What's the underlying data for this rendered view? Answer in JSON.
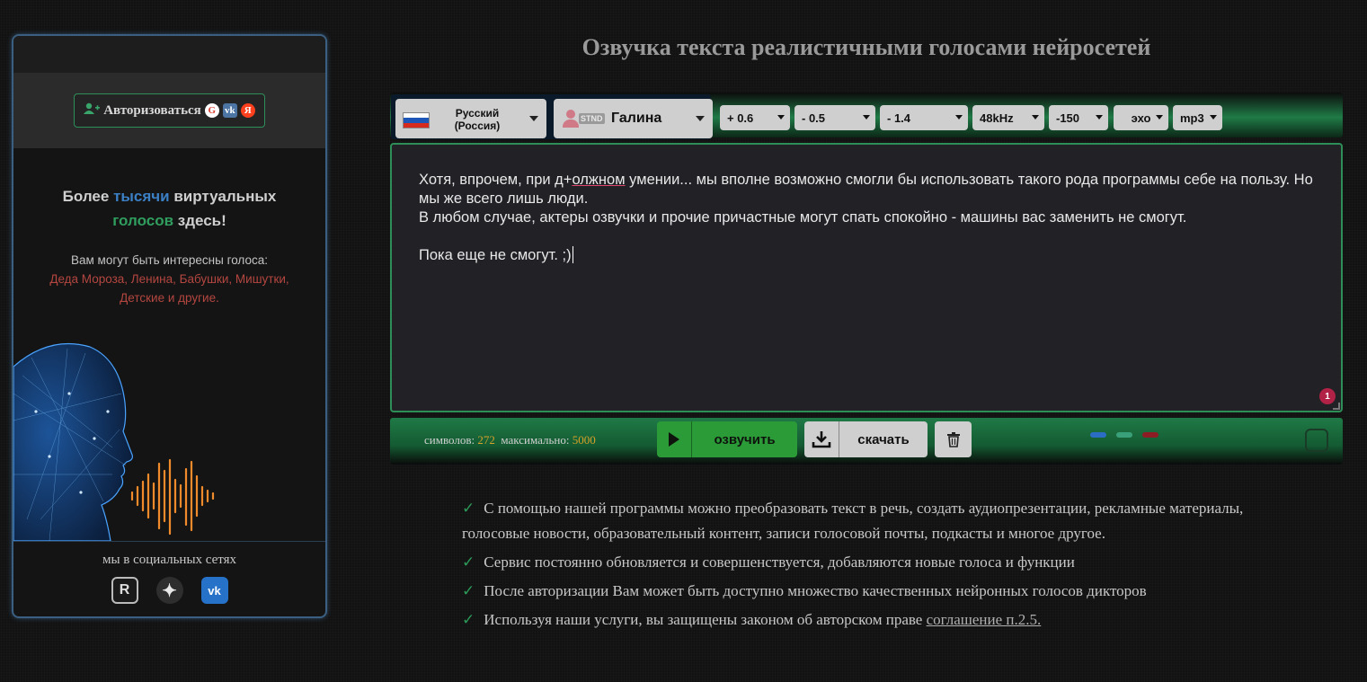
{
  "colors": {
    "accent_green": "#2e8e58",
    "play_green": "#2a9b37",
    "sidebar_border": "#3b5f80",
    "highlight_blue": "#3b7fc4",
    "highlight_red": "#b44640",
    "counter_value": "#d4a12a"
  },
  "sidebar": {
    "auth": {
      "icon": "user-plus-icon",
      "label": "Авторизоваться",
      "providers": [
        {
          "name": "google-icon",
          "glyph": "G"
        },
        {
          "name": "vk-icon",
          "glyph": "vk"
        },
        {
          "name": "yandex-icon",
          "glyph": "Я"
        }
      ]
    },
    "promo": {
      "part1": "Более ",
      "highlight1": "тысячи",
      "part2": " виртуальных",
      "highlight2": "голосов",
      "part3": " здесь!",
      "subtitle": "Вам могут быть интересны голоса:",
      "voices_list": "Деда Мороза, Ленина, Бабушки, Мишутки, Детские и другие."
    },
    "social": {
      "label": "мы в социальных сетях",
      "icons": [
        {
          "name": "rutube-icon",
          "glyph": "R"
        },
        {
          "name": "zen-icon",
          "glyph": "✦"
        },
        {
          "name": "vk-icon",
          "glyph": "vk"
        }
      ]
    }
  },
  "header": {
    "title": "Озвучка текста реалистичными голосами нейросетей"
  },
  "controls": {
    "language": {
      "line1": "Русский",
      "line2": "(Россия)",
      "flag": "russia-flag-icon"
    },
    "voice": {
      "badge": "STND",
      "name": "Галина",
      "icon": "female-avatar-icon"
    },
    "selects": [
      {
        "name": "speed-select",
        "value": "+ 0.6"
      },
      {
        "name": "pitch-select",
        "value": "- 0.5"
      },
      {
        "name": "volume-select",
        "value": "- 1.4"
      },
      {
        "name": "samplerate-select",
        "value": "48kHz"
      },
      {
        "name": "pause-select",
        "value": "-150"
      },
      {
        "name": "effect-select",
        "value": "эхо"
      },
      {
        "name": "format-select",
        "value": "mp3"
      }
    ]
  },
  "editor": {
    "line1_a": "Хотя, впрочем, при д+",
    "line1_b": "олжном",
    "line1_c": " умении... мы вполне возможно смогли бы использовать такого рода программы себе на пользу. Но мы же всего лишь люди.",
    "line2": "В любом случае, актеры озвучки и прочие причастные могут спать спокойно - машины вас заменить не смогут.",
    "line3": "Пока еще не смогут. ;)",
    "badge": "1"
  },
  "bottombar": {
    "chars_label": "символов:",
    "chars_value": "272",
    "max_label": "максимально:",
    "max_value": "5000",
    "speak_label": "озвучить",
    "download_label": "скачать"
  },
  "features": [
    "С помощью нашей программы можно преобразовать текст в речь, создать аудиопрезентации, рекламные материалы, голосовые новости, образовательный контент, записи голосовой почты, подкасты и многое другое.",
    "Сервис постоянно обновляется и совершенствуется, добавляются новые голоса и функции",
    "После авторизации Вам может быть доступно множество качественных нейронных голосов дикторов"
  ],
  "feature_last": {
    "text": "Используя наши услуги, вы защищены законом об авторском праве ",
    "link": "соглашение п.2.5."
  },
  "check_mark": "✓"
}
